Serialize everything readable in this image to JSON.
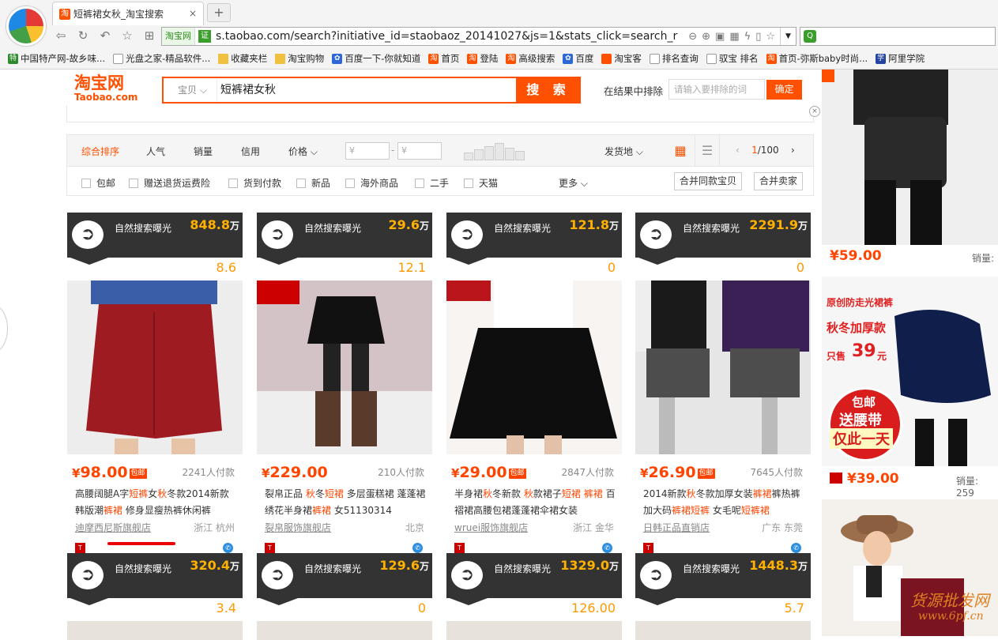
{
  "browser": {
    "tab_title": "短裤裙女秋_淘宝搜索",
    "tab_close": "×",
    "new_tab": "+",
    "address_site_label": "淘宝网",
    "address_ev": "证",
    "url": "s.taobao.com/search?initiative_id=staobaoz_20141027&js=1&stats_click=search_r",
    "bookmarks": [
      {
        "label": "中国特产网-故乡味...",
        "icon": "特"
      },
      {
        "label": "光盘之家-精品软件...",
        "icon": ""
      },
      {
        "label": "收藏夹栏",
        "icon": ""
      },
      {
        "label": "淘宝购物",
        "icon": ""
      },
      {
        "label": "百度一下-你就知道",
        "icon": "✿"
      },
      {
        "label": "首页",
        "icon": "淘"
      },
      {
        "label": "登陆",
        "icon": "淘"
      },
      {
        "label": "高级搜索",
        "icon": "淘"
      },
      {
        "label": "百度",
        "icon": "✿"
      },
      {
        "label": "淘宝客",
        "icon": ""
      },
      {
        "label": "排名查询",
        "icon": ""
      },
      {
        "label": "驭宝 排名",
        "icon": ""
      },
      {
        "label": "首页-弥斯baby时尚...",
        "icon": "淘"
      },
      {
        "label": "阿里学院",
        "icon": "学"
      }
    ]
  },
  "header": {
    "logo_cn": "淘宝网",
    "logo_en": "Taobao.com",
    "search_category": "宝贝",
    "search_query": "短裤裙女秋",
    "search_button": "搜 索",
    "exclude_label": "在结果中排除",
    "exclude_placeholder": "请输入要排除的词",
    "exclude_button": "确定"
  },
  "sort": {
    "items": [
      "综合排序",
      "人气",
      "销量",
      "信用",
      "价格 ⌵"
    ],
    "price_from": "¥",
    "price_dash": "-",
    "price_to": "¥",
    "ship_from": "发货地 ⌵",
    "page_current": "1",
    "page_total": "/100"
  },
  "filters": {
    "checks": [
      "包邮",
      "赠送退货运费险",
      "货到付款",
      "新品",
      "海外商品",
      "二手",
      "天猫"
    ],
    "more": "更多 ⌵",
    "merge_same": "合并同款宝贝",
    "merge_seller": "合并卖家"
  },
  "cards": [
    {
      "exposure_label": "自然搜索曝光",
      "exposure": "848.8",
      "unit": "万",
      "sub": "8.6",
      "price": "98.00",
      "free_ship": "包邮",
      "paid": "2241人付款",
      "title_parts": [
        [
          "高腰阔腿A字",
          ""
        ],
        [
          "短裤",
          "hl"
        ],
        [
          "女",
          ""
        ],
        [
          "秋",
          "hl"
        ],
        [
          "冬款2014新款韩版潮",
          ""
        ],
        [
          "裤裙",
          "hl"
        ],
        [
          " 修身显瘦热裤休闲裤",
          ""
        ]
      ],
      "shop": "迪摩西尼斯旗舰店",
      "location": "浙江 杭州"
    },
    {
      "exposure_label": "自然搜索曝光",
      "exposure": "29.6",
      "unit": "万",
      "sub": "12.1",
      "price": "229.00",
      "free_ship": "",
      "paid": "210人付款",
      "title_parts": [
        [
          "裂帛正品 ",
          ""
        ],
        [
          "秋",
          "hl"
        ],
        [
          "冬",
          ""
        ],
        [
          "短裙",
          "hl"
        ],
        [
          " 多层蛋糕裙 蓬蓬裙绣花半身裙",
          ""
        ],
        [
          "裤裙",
          "hl"
        ],
        [
          " 女51130314",
          ""
        ]
      ],
      "shop": "裂帛服饰旗舰店",
      "location": "北京"
    },
    {
      "exposure_label": "自然搜索曝光",
      "exposure": "121.8",
      "unit": "万",
      "sub": "0",
      "price": "29.00",
      "free_ship": "包邮",
      "paid": "2847人付款",
      "title_parts": [
        [
          "半身裙",
          ""
        ],
        [
          "秋",
          "hl"
        ],
        [
          "冬新款 ",
          ""
        ],
        [
          "秋",
          "hl"
        ],
        [
          "款裙子",
          ""
        ],
        [
          "短裙",
          "hl"
        ],
        [
          " ",
          ""
        ],
        [
          "裤裙",
          "hl"
        ],
        [
          " 百褶裙高腰包裙蓬蓬裙伞裙女装",
          ""
        ]
      ],
      "shop": "wruei服饰旗舰店",
      "location": "浙江 金华"
    },
    {
      "exposure_label": "自然搜索曝光",
      "exposure": "2291.9",
      "unit": "万",
      "sub": "0",
      "price": "26.90",
      "free_ship": "包邮",
      "paid": "7645人付款",
      "title_parts": [
        [
          "2014新款",
          ""
        ],
        [
          "秋",
          "hl"
        ],
        [
          "冬款加厚女装",
          ""
        ],
        [
          "裤裙",
          "hl"
        ],
        [
          "裤热裤加大码",
          ""
        ],
        [
          "裤裙短裤",
          "hl"
        ],
        [
          " 女毛呢",
          ""
        ],
        [
          "短裤裙",
          "hl"
        ]
      ],
      "shop": "日韩正品直销店",
      "location": "广东 东莞"
    }
  ],
  "cards_row2": [
    {
      "exposure_label": "自然搜索曝光",
      "exposure": "320.4",
      "unit": "万",
      "sub": "3.4"
    },
    {
      "exposure_label": "自然搜索曝光",
      "exposure": "129.6",
      "unit": "万",
      "sub": "0"
    },
    {
      "exposure_label": "自然搜索曝光",
      "exposure": "1329.0",
      "unit": "万",
      "sub": "126.00"
    },
    {
      "exposure_label": "自然搜索曝光",
      "exposure": "1448.3",
      "unit": "万",
      "sub": "5.7"
    }
  ],
  "ads": [
    {
      "price": "¥59.00",
      "sales": "销量:"
    },
    {
      "text1": "原创防走光裙裤",
      "text2": "秋冬加厚款",
      "text3": "只售",
      "price_big": "39",
      "yuan": "元",
      "badge1": "包邮",
      "badge2": "送腰带",
      "badge3": "仅此一天",
      "price": "¥39.00",
      "sales": "销量: 259"
    }
  ],
  "watermark": "货源批发网",
  "watermark_url": "www.6pf.cn",
  "colors": {
    "accent": "#ff5000",
    "price": "#ff4400",
    "banner": "#333333",
    "exposure": "#ffb000"
  }
}
